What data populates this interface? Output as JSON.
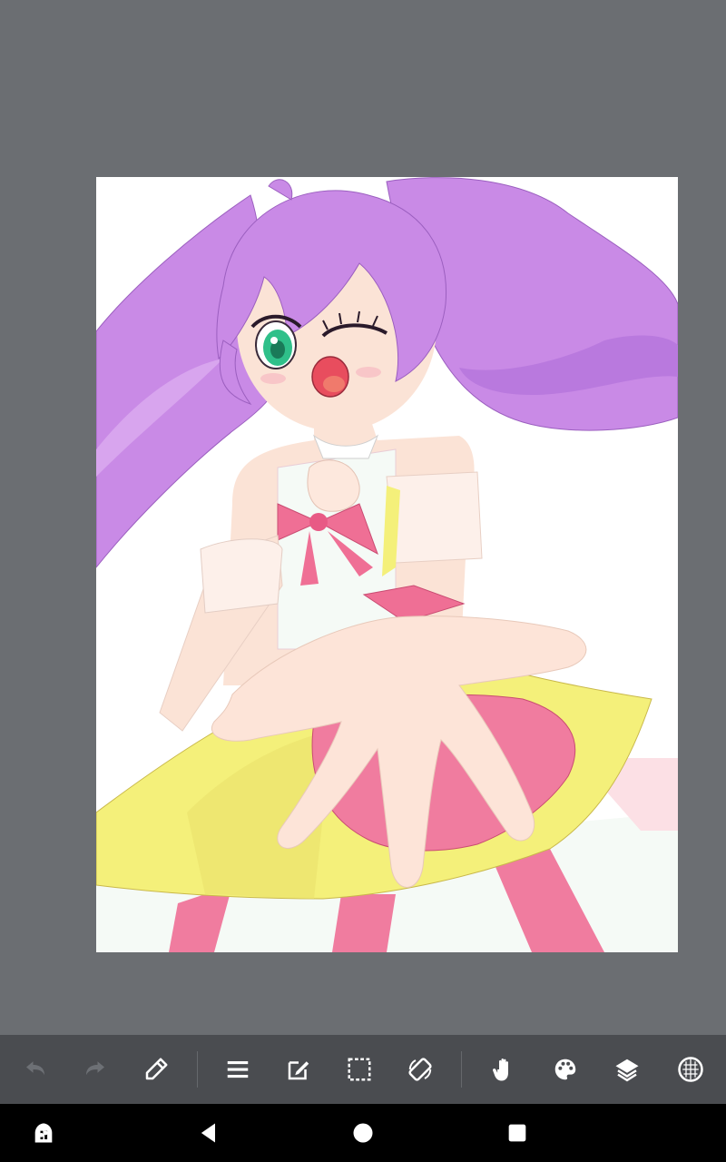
{
  "app": {
    "background_color": "#6b6e72",
    "toolbar_color": "#4a4c50"
  },
  "canvas": {
    "artwork": "anime-girl-illustration",
    "palette": {
      "hair": "#c98ae6",
      "skin": "#fbe3d6",
      "eye": "#2fc08a",
      "bow": "#ef6f95",
      "skirt_yellow": "#f4f07a",
      "skirt_pink": "#f07c9f"
    }
  },
  "toolbar": {
    "buttons": [
      {
        "id": "undo",
        "icon": "undo-icon",
        "enabled": false
      },
      {
        "id": "redo",
        "icon": "redo-icon",
        "enabled": false
      },
      {
        "id": "eyedropper",
        "icon": "eyedropper-icon",
        "enabled": true
      },
      {
        "id": "menu",
        "icon": "hamburger-menu-icon",
        "enabled": true
      },
      {
        "id": "edit",
        "icon": "edit-icon",
        "enabled": true
      },
      {
        "id": "selection",
        "icon": "selection-icon",
        "enabled": true
      },
      {
        "id": "rotate",
        "icon": "rotate-screen-icon",
        "enabled": true
      },
      {
        "id": "hand",
        "icon": "hand-tool-icon",
        "enabled": true
      },
      {
        "id": "palette",
        "icon": "palette-icon",
        "enabled": true
      },
      {
        "id": "layers",
        "icon": "layers-icon",
        "enabled": true
      },
      {
        "id": "materials",
        "icon": "materials-icon",
        "enabled": true
      }
    ]
  },
  "navbar": {
    "buttons": [
      "pen-settings-icon",
      "back-icon",
      "home-icon",
      "recents-icon"
    ]
  }
}
